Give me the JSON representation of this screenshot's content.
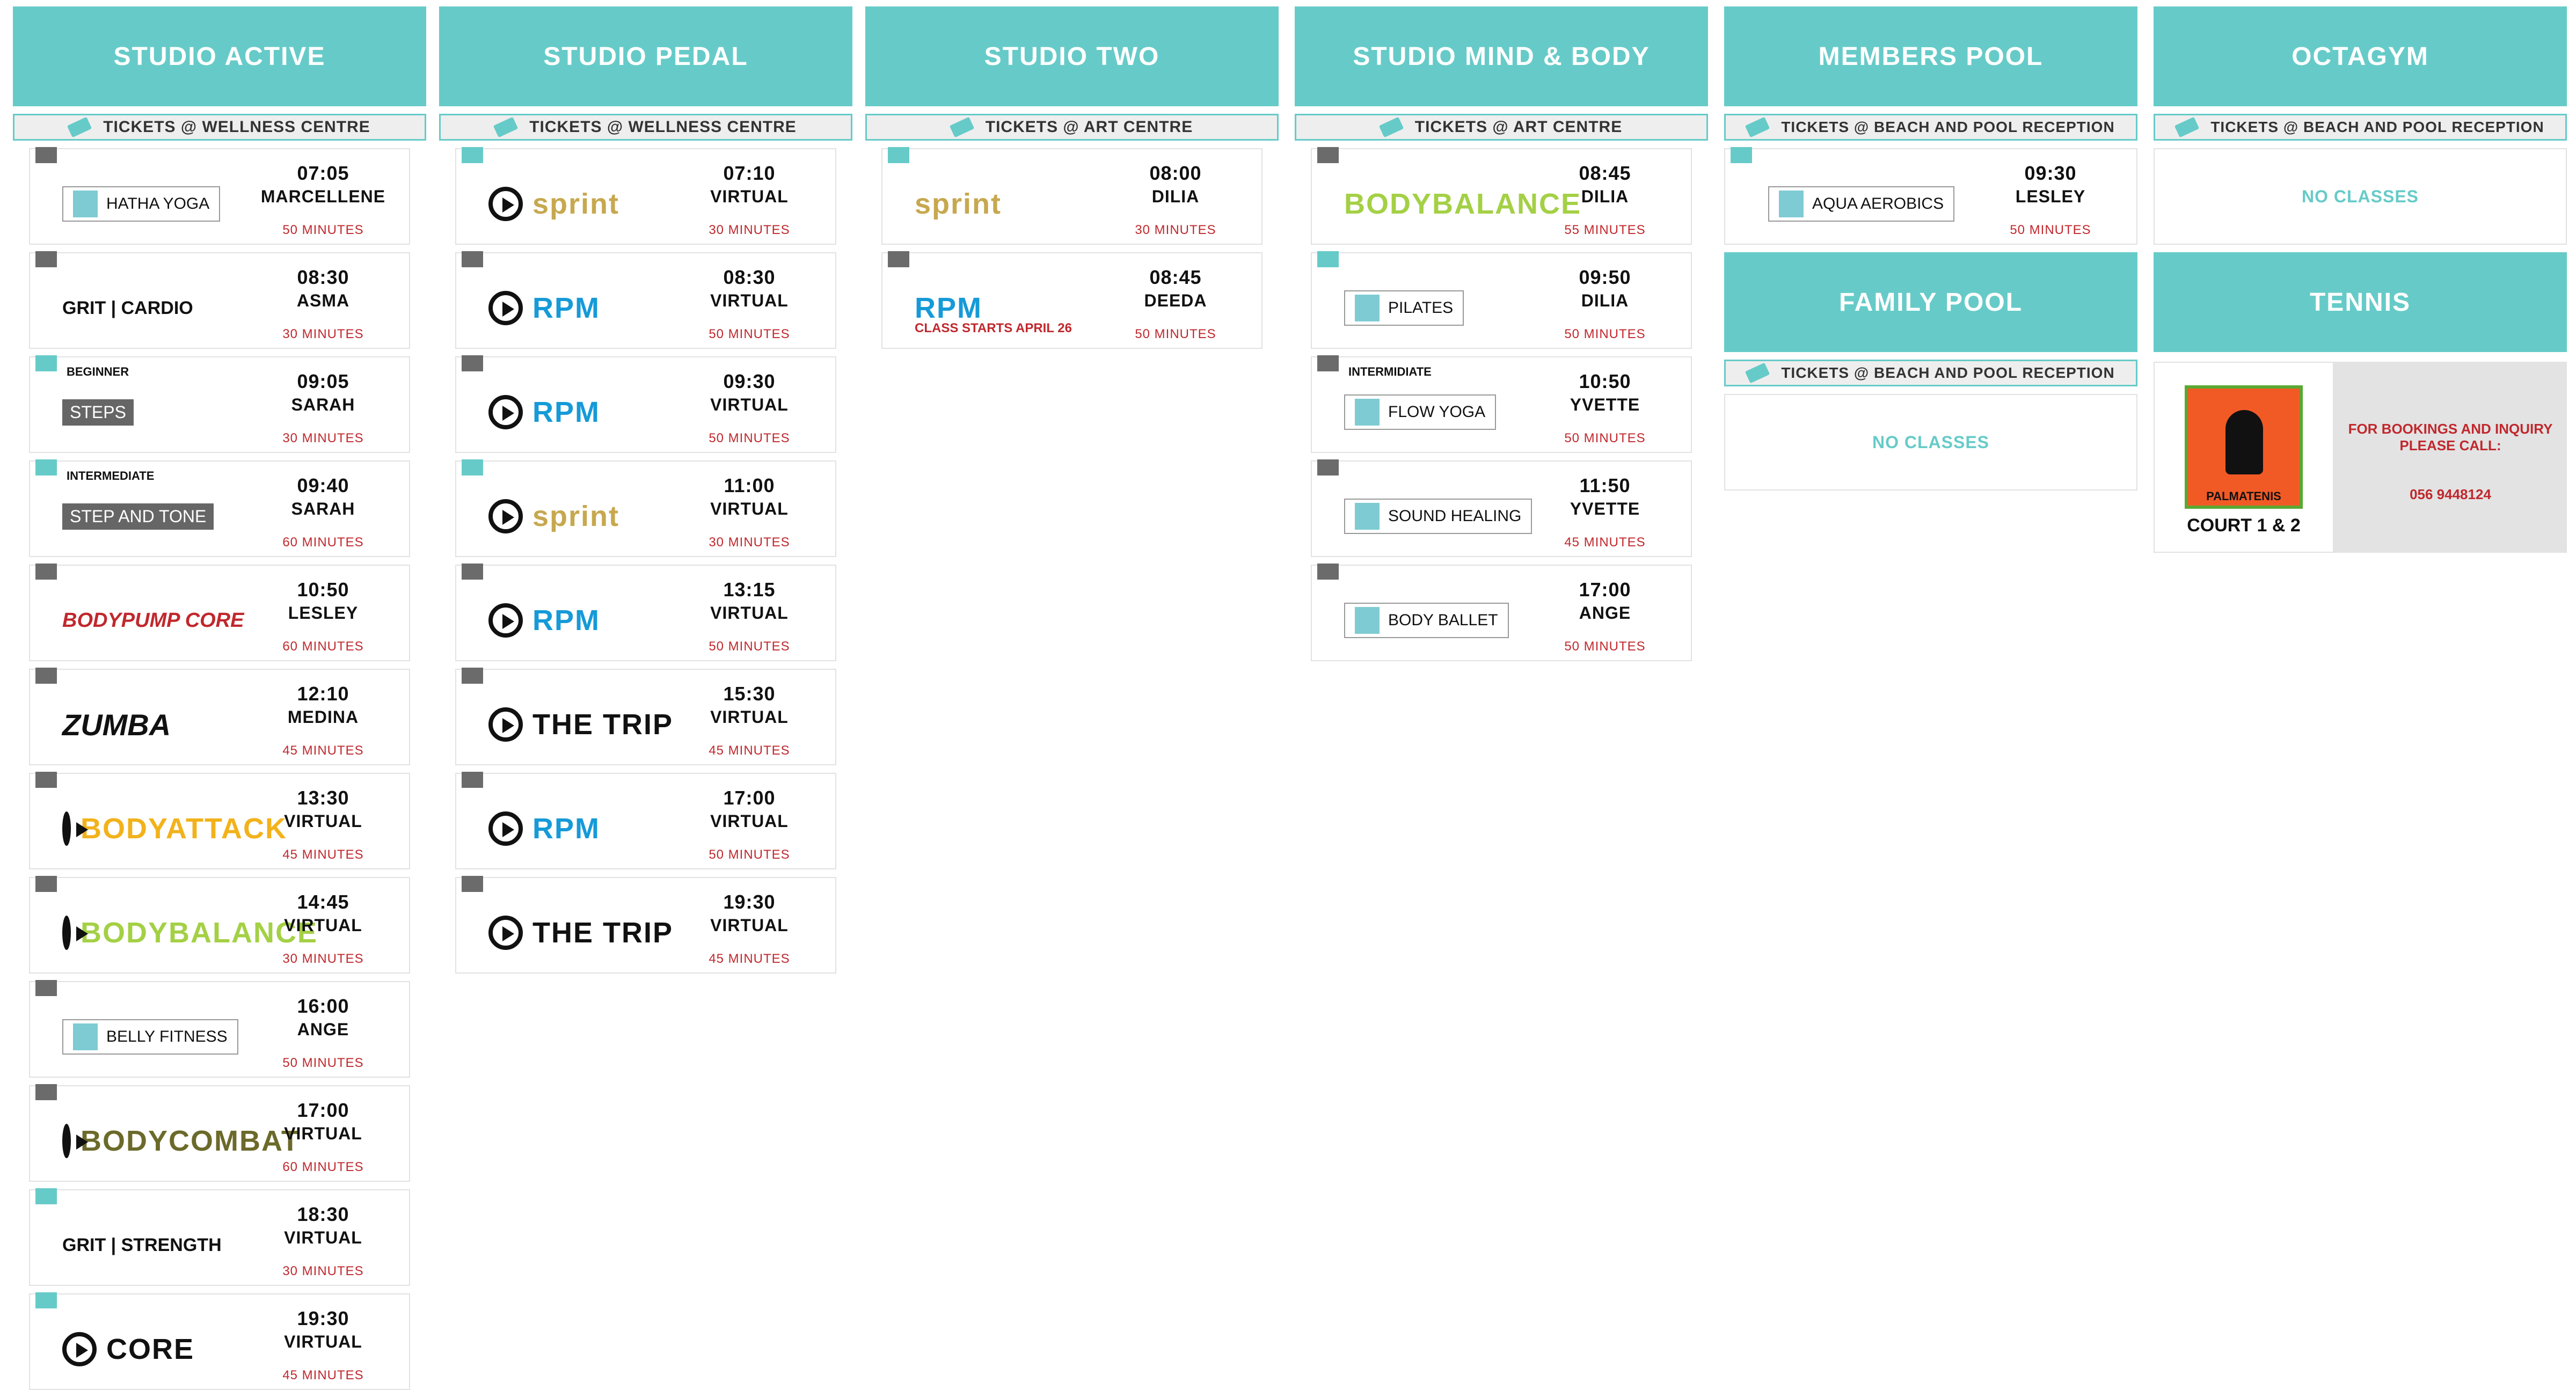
{
  "columns": [
    {
      "id": "active",
      "title": "STUDIO ACTIVE",
      "tickets": "TICKETS @ WELLNESS CENTRE",
      "classes": [
        {
          "logo": "HATHA YOGA",
          "logo_style": "box",
          "time": "07:05",
          "instructor": "MARCELLENE",
          "duration": "50 MINUTES",
          "flag": "grey"
        },
        {
          "logo": "GRIT | CARDIO",
          "logo_style": "grit",
          "time": "08:30",
          "instructor": "ASMA",
          "duration": "30 MINUTES",
          "flag": "grey"
        },
        {
          "level": "BEGINNER",
          "logo": "STEPS",
          "logo_style": "steps",
          "time": "09:05",
          "instructor": "SARAH",
          "duration": "30 MINUTES",
          "flag": "teal"
        },
        {
          "level": "INTERMEDIATE",
          "logo": "STEP AND TONE",
          "logo_style": "steps",
          "time": "09:40",
          "instructor": "SARAH",
          "duration": "60 MINUTES",
          "flag": "teal"
        },
        {
          "logo": "BODYPUMP CORE",
          "logo_style": "pump",
          "time": "10:50",
          "instructor": "LESLEY",
          "duration": "60 MINUTES",
          "flag": "grey"
        },
        {
          "logo": "ZUMBA",
          "logo_style": "zumba",
          "time": "12:10",
          "instructor": "MEDINA",
          "duration": "45 MINUTES",
          "flag": "grey"
        },
        {
          "logo": "BODYATTACK",
          "logo_style": "lm-attack",
          "time": "13:30",
          "instructor": "VIRTUAL",
          "duration": "45 MINUTES",
          "flag": "grey"
        },
        {
          "logo": "BODYBALANCE",
          "logo_style": "lm-balance",
          "time": "14:45",
          "instructor": "VIRTUAL",
          "duration": "30 MINUTES",
          "flag": "grey"
        },
        {
          "logo": "BELLY FITNESS",
          "logo_style": "box",
          "time": "16:00",
          "instructor": "ANGE",
          "duration": "50 MINUTES",
          "flag": "grey"
        },
        {
          "logo": "BODYCOMBAT",
          "logo_style": "lm-combat",
          "time": "17:00",
          "instructor": "VIRTUAL",
          "duration": "60 MINUTES",
          "flag": "grey"
        },
        {
          "logo": "GRIT | STRENGTH",
          "logo_style": "grit",
          "time": "18:30",
          "instructor": "VIRTUAL",
          "duration": "30 MINUTES",
          "flag": "teal"
        },
        {
          "logo": "CORE",
          "logo_style": "lm-core",
          "time": "19:30",
          "instructor": "VIRTUAL",
          "duration": "45 MINUTES",
          "flag": "teal"
        }
      ]
    },
    {
      "id": "pedal",
      "title": "STUDIO PEDAL",
      "tickets": "TICKETS @ WELLNESS CENTRE",
      "classes": [
        {
          "logo": "sprint",
          "logo_style": "lm-sprint",
          "time": "07:10",
          "instructor": "VIRTUAL",
          "duration": "30 MINUTES",
          "flag": "teal"
        },
        {
          "logo": "RPM",
          "logo_style": "lm-rpm",
          "time": "08:30",
          "instructor": "VIRTUAL",
          "duration": "50 MINUTES",
          "flag": "grey"
        },
        {
          "logo": "RPM",
          "logo_style": "lm-rpm",
          "time": "09:30",
          "instructor": "VIRTUAL",
          "duration": "50 MINUTES",
          "flag": "grey"
        },
        {
          "logo": "sprint",
          "logo_style": "lm-sprint",
          "time": "11:00",
          "instructor": "VIRTUAL",
          "duration": "30 MINUTES",
          "flag": "teal"
        },
        {
          "logo": "RPM",
          "logo_style": "lm-rpm",
          "time": "13:15",
          "instructor": "VIRTUAL",
          "duration": "50 MINUTES",
          "flag": "grey"
        },
        {
          "logo": "THE TRIP",
          "logo_style": "lm-trip",
          "time": "15:30",
          "instructor": "VIRTUAL",
          "duration": "45 MINUTES",
          "flag": "grey"
        },
        {
          "logo": "RPM",
          "logo_style": "lm-rpm",
          "time": "17:00",
          "instructor": "VIRTUAL",
          "duration": "50 MINUTES",
          "flag": "grey"
        },
        {
          "logo": "THE TRIP",
          "logo_style": "lm-trip",
          "time": "19:30",
          "instructor": "VIRTUAL",
          "duration": "45 MINUTES",
          "flag": "grey"
        }
      ]
    },
    {
      "id": "two",
      "title": "STUDIO TWO",
      "tickets": "TICKETS @ ART CENTRE",
      "classes": [
        {
          "logo": "sprint",
          "logo_style": "lm-sprint-plain",
          "time": "08:00",
          "instructor": "DILIA",
          "duration": "30 MINUTES",
          "flag": "teal"
        },
        {
          "logo": "RPM",
          "logo_style": "lm-rpm-plain",
          "time": "08:45",
          "instructor": "DEEDA",
          "duration": "50 MINUTES",
          "flag": "grey",
          "note": "CLASS STARTS APRIL 26"
        }
      ]
    },
    {
      "id": "mindbody",
      "title": "STUDIO MIND & BODY",
      "tickets": "TICKETS @ ART CENTRE",
      "classes": [
        {
          "logo": "BODYBALANCE",
          "logo_style": "lm-balance-plain",
          "time": "08:45",
          "instructor": "DILIA",
          "duration": "55 MINUTES",
          "flag": "grey"
        },
        {
          "logo": "PILATES",
          "logo_style": "box",
          "time": "09:50",
          "instructor": "DILIA",
          "duration": "50 MINUTES",
          "flag": "teal"
        },
        {
          "level": "INTERMIDIATE",
          "logo": "FLOW YOGA",
          "logo_style": "box",
          "time": "10:50",
          "instructor": "YVETTE",
          "duration": "50 MINUTES",
          "flag": "grey"
        },
        {
          "logo": "SOUND HEALING",
          "logo_style": "box",
          "time": "11:50",
          "instructor": "YVETTE",
          "duration": "45 MINUTES",
          "flag": "grey"
        },
        {
          "logo": "BODY BALLET",
          "logo_style": "box",
          "time": "17:00",
          "instructor": "ANGE",
          "duration": "50 MINUTES",
          "flag": "grey"
        }
      ]
    }
  ],
  "members_pool": {
    "title": "MEMBERS POOL",
    "tickets": "TICKETS @ BEACH AND POOL RECEPTION",
    "class": {
      "logo": "AQUA AEROBICS",
      "time": "09:30",
      "instructor": "LESLEY",
      "duration": "50 MINUTES"
    }
  },
  "family_pool": {
    "title": "FAMILY POOL",
    "tickets": "TICKETS @ BEACH AND POOL RECEPTION",
    "empty": "NO CLASSES"
  },
  "octagym": {
    "title": "OCTAGYM",
    "tickets": "TICKETS @ BEACH AND POOL RECEPTION",
    "empty": "NO CLASSES"
  },
  "tennis": {
    "title": "TENNIS",
    "logo_text": "PALMATENIS",
    "court": "COURT 1 & 2",
    "info": "FOR BOOKINGS AND INQUIRY PLEASE CALL:",
    "phone": "056 9448124"
  },
  "colors": {
    "accent": "#66cbc8",
    "duration": "#c0282d",
    "flag_grey": "#6b6b6b"
  }
}
